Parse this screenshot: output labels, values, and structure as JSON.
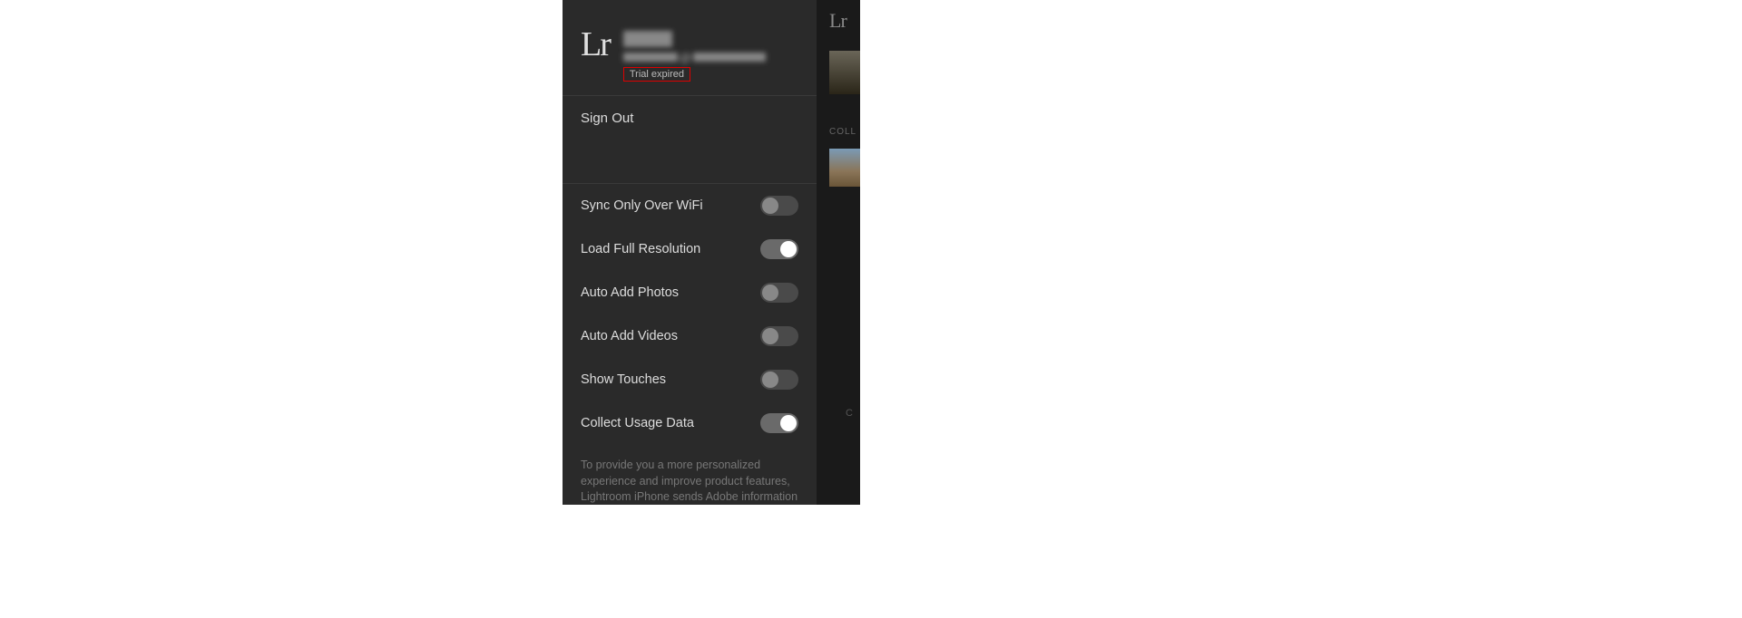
{
  "profile": {
    "logo_text": "Lr",
    "email_at": "@",
    "trial_status": "Trial expired"
  },
  "actions": {
    "sign_out": "Sign Out"
  },
  "settings": [
    {
      "label": "Sync Only Over WiFi",
      "on": false
    },
    {
      "label": "Load Full Resolution",
      "on": true
    },
    {
      "label": "Auto Add Photos",
      "on": false
    },
    {
      "label": "Auto Add Videos",
      "on": false
    },
    {
      "label": "Show Touches",
      "on": false
    },
    {
      "label": "Collect Usage Data",
      "on": true
    }
  ],
  "footer": {
    "text": "To provide you a more personalized experience and improve product features, Lightroom iPhone sends Adobe information"
  },
  "background": {
    "logo": "Lr",
    "coll_label": "COLL",
    "c_label": "C"
  }
}
